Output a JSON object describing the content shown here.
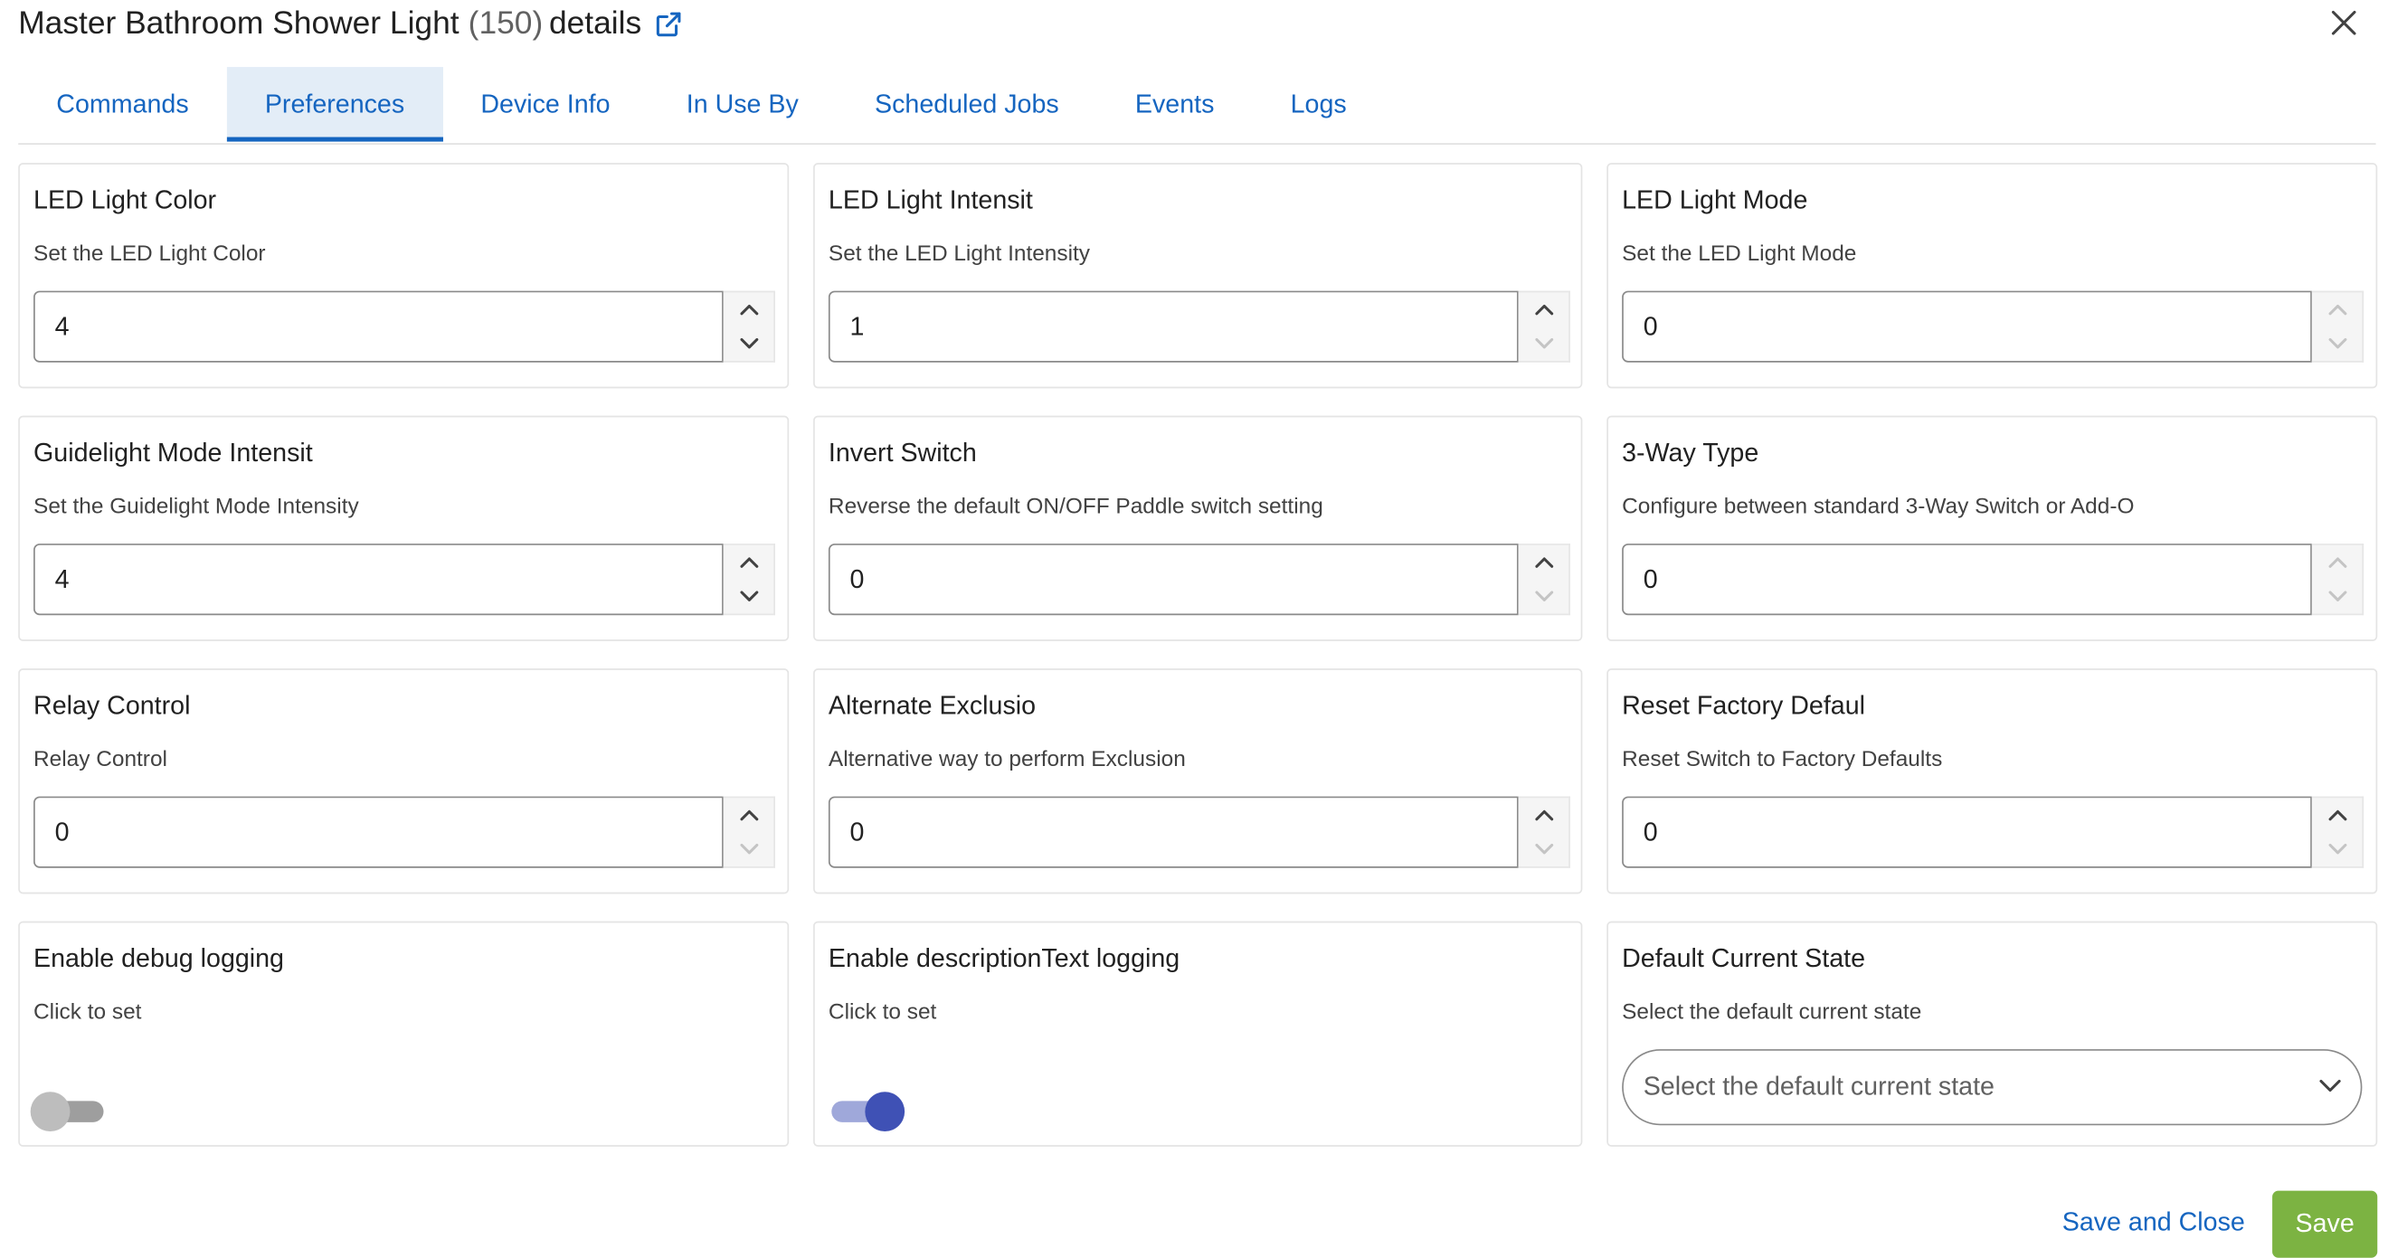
{
  "dialog": {
    "title": "Master Bathroom Shower Light",
    "device_id": "(150)",
    "title_suffix": "details",
    "external_link_icon": "external-link-icon",
    "close_icon": "close-icon"
  },
  "tabs": [
    {
      "label": "Commands",
      "active": false
    },
    {
      "label": "Preferences",
      "active": true
    },
    {
      "label": "Device Info",
      "active": false
    },
    {
      "label": "In Use By",
      "active": false
    },
    {
      "label": "Scheduled Jobs",
      "active": false
    },
    {
      "label": "Events",
      "active": false
    },
    {
      "label": "Logs",
      "active": false
    }
  ],
  "preferences": [
    {
      "title": "LED Light Color",
      "desc": "Set the LED Light Color",
      "type": "number",
      "value": "4",
      "up_enabled": true,
      "down_enabled": true
    },
    {
      "title": "LED Light Intensit",
      "desc": "Set the LED Light Intensity",
      "type": "number",
      "value": "1",
      "up_enabled": true,
      "down_enabled": false
    },
    {
      "title": "LED Light Mode",
      "desc": "Set the LED Light Mode",
      "type": "number",
      "value": "0",
      "up_enabled": false,
      "down_enabled": false
    },
    {
      "title": "Guidelight Mode Intensit",
      "desc": "Set the Guidelight Mode Intensity",
      "type": "number",
      "value": "4",
      "up_enabled": true,
      "down_enabled": true
    },
    {
      "title": "Invert Switch",
      "desc": "Reverse the default ON/OFF Paddle switch setting",
      "type": "number",
      "value": "0",
      "up_enabled": true,
      "down_enabled": false
    },
    {
      "title": "3-Way Type",
      "desc": "Configure between standard 3-Way Switch or Add-O",
      "type": "number",
      "value": "0",
      "up_enabled": false,
      "down_enabled": false
    },
    {
      "title": "Relay Control",
      "desc": "Relay Control",
      "type": "number",
      "value": "0",
      "up_enabled": true,
      "down_enabled": false
    },
    {
      "title": "Alternate Exclusio",
      "desc": "Alternative way to perform Exclusion",
      "type": "number",
      "value": "0",
      "up_enabled": true,
      "down_enabled": false
    },
    {
      "title": "Reset Factory Defaul",
      "desc": "Reset Switch to Factory Defaults",
      "type": "number",
      "value": "0",
      "up_enabled": true,
      "down_enabled": false
    },
    {
      "title": "Enable debug logging",
      "desc": "Click to set",
      "type": "toggle",
      "checked": false
    },
    {
      "title": "Enable descriptionText logging",
      "desc": "Click to set",
      "type": "toggle",
      "checked": true
    },
    {
      "title": "Default Current State",
      "desc": "Select the default current state",
      "type": "select",
      "placeholder": "Select the default current state"
    }
  ],
  "footer": {
    "save_close_label": "Save and Close",
    "save_label": "Save"
  },
  "colors": {
    "accent": "#1565c0",
    "toggle_on": "#3f51b5",
    "save_button": "#7cb342"
  }
}
